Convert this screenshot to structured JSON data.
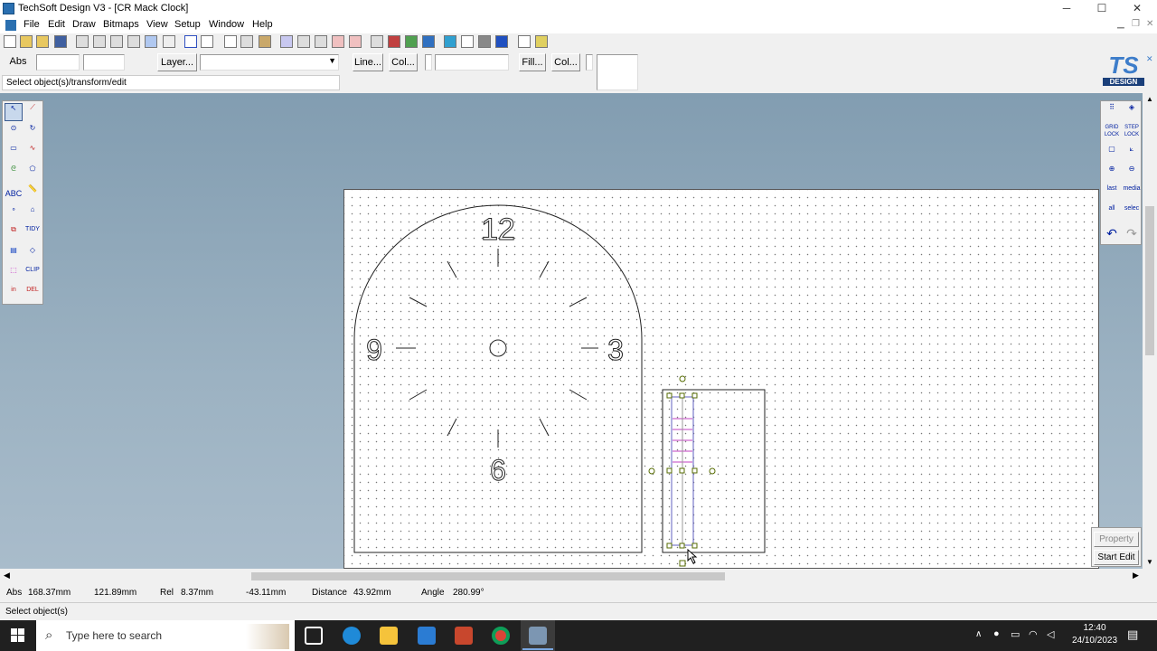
{
  "window": {
    "title": "TechSoft Design V3 - [CR Mack Clock]",
    "minimize": "─",
    "maximize": "☐",
    "close": "✕"
  },
  "menu": [
    "File",
    "Edit",
    "Draw",
    "Bitmaps",
    "View",
    "Setup",
    "Window",
    "Help"
  ],
  "toolbar2": {
    "abs_label": "Abs",
    "layer_label": "Layer...",
    "line_label": "Line...",
    "col1_label": "Col...",
    "fill_label": "Fill...",
    "col2_label": "Col...",
    "hint": "Select object(s)/transform/edit"
  },
  "logo": {
    "line1": "TS",
    "line2": "DESIGN"
  },
  "left_tools": [
    "ABC",
    "TIDY",
    "CLIP",
    "in",
    "DEL"
  ],
  "right_tools": [
    "GRID LOCK",
    "STEP LOCK",
    "last",
    "media",
    "all",
    "selec"
  ],
  "clock": {
    "n12": "12",
    "n3": "3",
    "n6": "6",
    "n9": "9"
  },
  "property_panel": {
    "property": "Property",
    "start_edit": "Start Edit"
  },
  "coords": {
    "abs_label": "Abs",
    "abs_x": "168.37mm",
    "abs_y": "121.89mm",
    "rel_label": "Rel",
    "rel_x": "8.37mm",
    "rel_y": "-43.11mm",
    "distance_label": "Distance",
    "distance": "43.92mm",
    "angle_label": "Angle",
    "angle": "280.99°"
  },
  "status": "Select object(s)",
  "taskbar": {
    "search_placeholder": "Type here to search",
    "time": "12:40",
    "date": "24/10/2023"
  }
}
